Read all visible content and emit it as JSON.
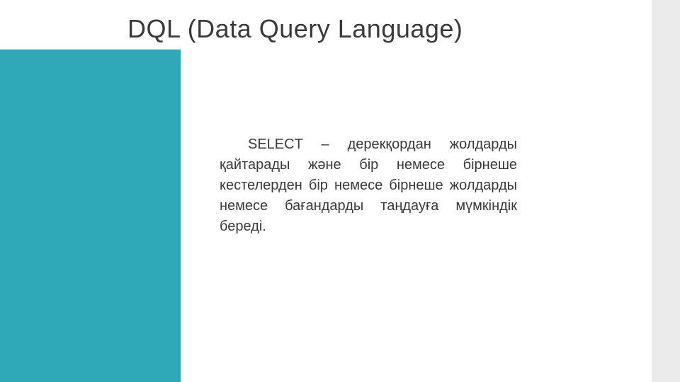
{
  "slide": {
    "title": "DQL (Data Query Language)",
    "body": "SELECT – дерекқордан жолдарды қайтарады және бір немесе бірнеше кестелерден бір немесе бірнеше жолдарды немесе бағандарды таңдауға мүмкіндік береді."
  },
  "colors": {
    "accent": "#2fa8b8",
    "rightBar": "#ebebeb",
    "text": "#3a3a3a"
  }
}
